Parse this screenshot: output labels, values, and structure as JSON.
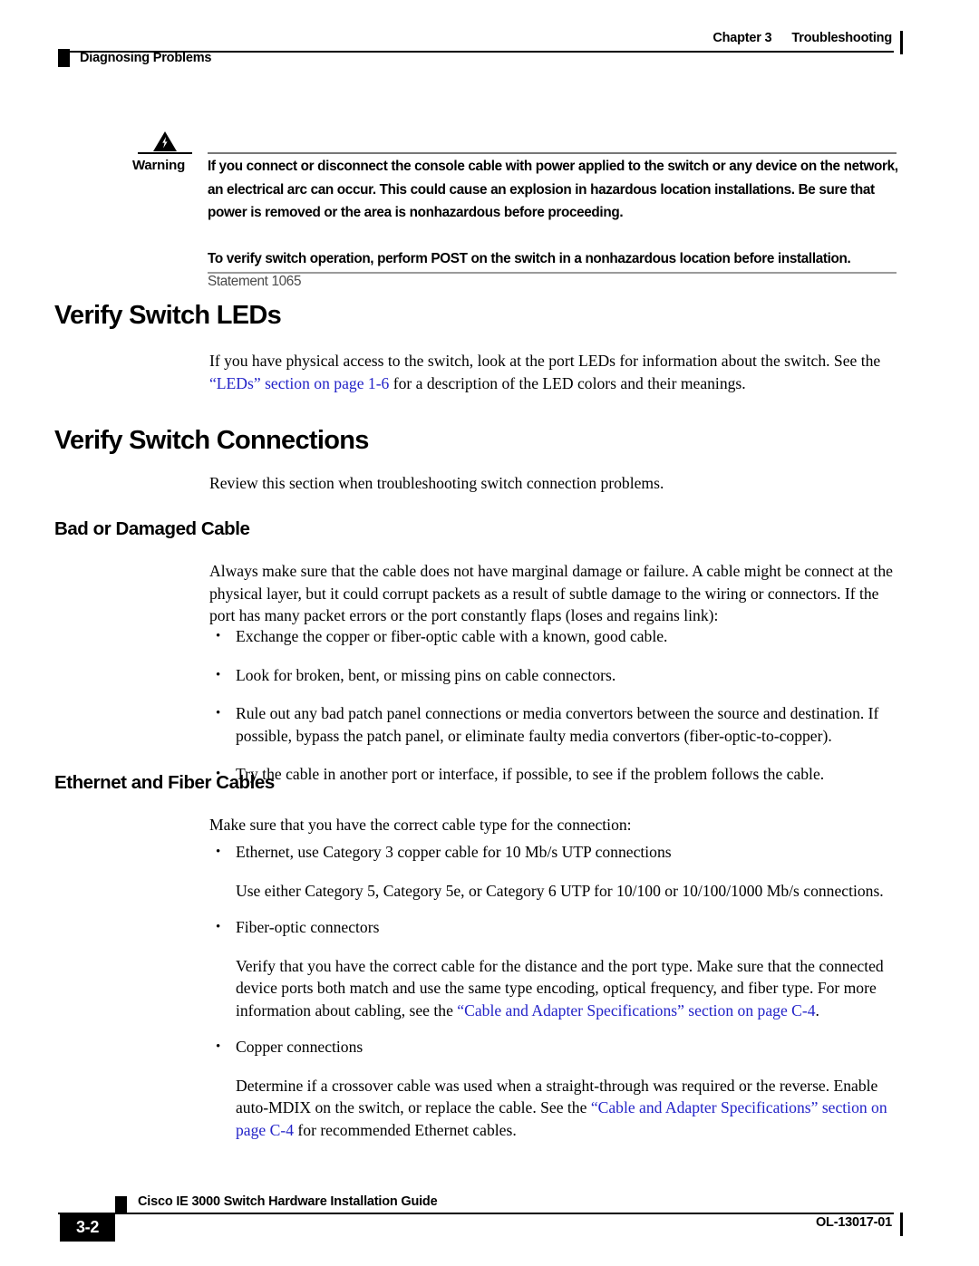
{
  "header": {
    "running_head_left": "Diagnosing Problems",
    "chapter_label": "Chapter 3",
    "chapter_title": "Troubleshooting"
  },
  "warning": {
    "icon": "warning-lightning-triangle-icon",
    "label": "Warning",
    "paragraph_1": "If you connect or disconnect the console cable with power applied to the switch or any device on the network, an electrical arc can occur. This could cause an explosion in hazardous location installations. Be sure that power is removed or the area is nonhazardous before proceeding.",
    "paragraph_2_bold": "To verify switch operation, perform POST on the switch in a nonhazardous location before installation.",
    "paragraph_2_statement": " Statement 1065"
  },
  "sections": {
    "verify_leds": {
      "heading": "Verify Switch LEDs",
      "para_part_1": "If you have physical access to the switch, look at the port LEDs for information about the switch. See the ",
      "para_link": "“LEDs” section on page 1-6",
      "para_part_2": " for a description of the LED colors and their meanings."
    },
    "verify_connections": {
      "heading": "Verify Switch Connections",
      "intro": "Review this section when troubleshooting switch connection problems."
    },
    "bad_cable": {
      "heading": "Bad or Damaged Cable",
      "intro": "Always make sure that the cable does not have marginal damage or failure. A cable might be connect at the physical layer, but it could corrupt packets as a result of subtle damage to the wiring or connectors. If the port has many packet errors or the port constantly flaps (loses and regains link):",
      "bullets": [
        "Exchange the copper or fiber-optic cable with a known, good cable.",
        "Look for broken, bent, or missing pins on cable connectors.",
        "Rule out any bad patch panel connections or media convertors between the source and destination. If possible, bypass the patch panel, or eliminate faulty media convertors (fiber-optic-to-copper).",
        "Try the cable in another port or interface, if possible, to see if the problem follows the cable."
      ]
    },
    "ethernet_fiber": {
      "heading": "Ethernet and Fiber Cables",
      "intro": "Make sure that you have the correct cable type for the connection:",
      "bullet_ethernet": "Ethernet, use Category 3 copper cable for 10 Mb/s UTP connections",
      "sub_ethernet": "Use either Category 5, Category 5e, or Category 6 UTP for 10/100 or 10/100/1000 Mb/s connections.",
      "bullet_fiber": "Fiber-optic connectors",
      "sub_fiber_part_1": "Verify that you have the correct cable for the distance and the port type. Make sure that the connected device ports both match and use the same type encoding, optical frequency, and fiber type. For more information about cabling, see the ",
      "sub_fiber_link": "“Cable and Adapter Specifications” section on page C-4",
      "sub_fiber_part_2": ".",
      "bullet_copper": "Copper connections",
      "sub_copper_part_1": "Determine if a crossover cable was used when a straight-through was required or the reverse. Enable auto-MDIX on the switch, or replace the cable. See the ",
      "sub_copper_link": "“Cable and Adapter Specifications” section on page C-4",
      "sub_copper_part_2": " for recommended Ethernet cables."
    }
  },
  "footer": {
    "page_number": "3-2",
    "doc_title": "Cisco IE 3000 Switch Hardware Installation Guide",
    "doc_id": "OL-13017-01"
  },
  "colors": {
    "link": "#2323c8",
    "rule_gray": "#9b9b9b",
    "text": "#000000"
  }
}
